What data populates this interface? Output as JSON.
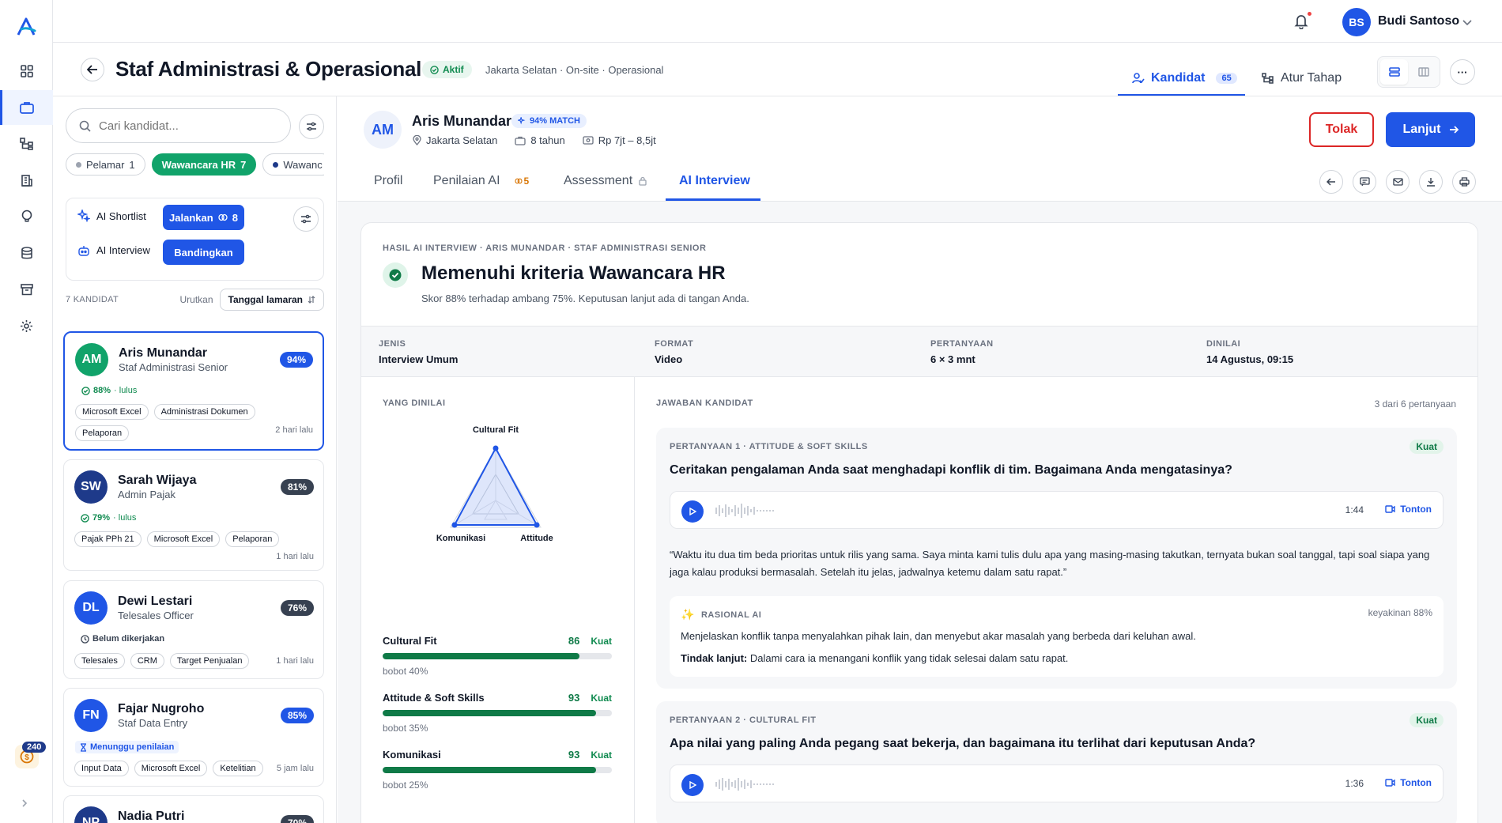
{
  "user": {
    "initials": "BS",
    "name": "Budi Santoso"
  },
  "credit_count": "240",
  "job": {
    "title": "Staf Administrasi & Operasional",
    "status": "Aktif",
    "meta": "Jakarta Selatan · On-site · Operasional"
  },
  "header_tabs": {
    "kandidat": "Kandidat",
    "kandidat_count": "65",
    "atur_tahap": "Atur Tahap"
  },
  "search": {
    "placeholder": "Cari kandidat..."
  },
  "stages": [
    {
      "label": "Pelamar",
      "count": "1"
    },
    {
      "label": "Wawancara HR",
      "count": "7"
    },
    {
      "label": "Wawanc"
    }
  ],
  "ai_tools": {
    "shortlist_label": "AI Shortlist",
    "shortlist_button": "Jalankan",
    "shortlist_credit": "8",
    "interview_label": "AI Interview",
    "interview_button": "Bandingkan"
  },
  "list_meta": {
    "count_label": "7 KANDIDAT",
    "sort_label": "Urutkan",
    "sort_value": "Tanggal lamaran"
  },
  "candidates": [
    {
      "initials": "AM",
      "name": "Aris Munandar",
      "role": "Staf Administrasi Senior",
      "match": "94%",
      "status_score": "88%",
      "status_suffix": "· lulus",
      "tags": [
        "Microsoft Excel",
        "Administrasi Dokumen",
        "Pelaporan"
      ],
      "ago": "2 hari lalu",
      "avatar_color": "#11a36a",
      "badge_color": "#2056e6"
    },
    {
      "initials": "SW",
      "name": "Sarah Wijaya",
      "role": "Admin Pajak",
      "match": "81%",
      "status_score": "79%",
      "status_suffix": "· lulus",
      "tags": [
        "Pajak PPh 21",
        "Microsoft Excel",
        "Pelaporan"
      ],
      "ago": "1 hari lalu",
      "avatar_color": "#1e3a8a",
      "badge_color": "#374151"
    },
    {
      "initials": "DL",
      "name": "Dewi Lestari",
      "role": "Telesales Officer",
      "match": "76%",
      "status_text": "Belum dikerjakan",
      "tags": [
        "Telesales",
        "CRM",
        "Target Penjualan"
      ],
      "ago": "1 hari lalu",
      "avatar_color": "#2056e6",
      "badge_color": "#374151"
    },
    {
      "initials": "FN",
      "name": "Fajar Nugroho",
      "role": "Staf Data Entry",
      "match": "85%",
      "status_text": "Menunggu penilaian",
      "tags": [
        "Input Data",
        "Microsoft Excel",
        "Ketelitian"
      ],
      "ago": "5 jam lalu",
      "avatar_color": "#2056e6",
      "badge_color": "#2056e6"
    },
    {
      "initials": "NP",
      "name": "Nadia Putri",
      "match": "70%",
      "avatar_color": "#1e3a8a",
      "badge_color": "#374151"
    }
  ],
  "selected": {
    "initials": "AM",
    "name": "Aris Munandar",
    "match": "94% MATCH",
    "location": "Jakarta Selatan",
    "experience": "8 tahun",
    "salary": "Rp 7jt – 8,5jt",
    "reject_label": "Tolak",
    "next_label": "Lanjut"
  },
  "detail_tabs": {
    "profil": "Profil",
    "penilaian": "Penilaian AI",
    "penilaian_count": "5",
    "assessment": "Assessment",
    "ai_interview": "AI Interview"
  },
  "result": {
    "eyebrow": "HASIL AI INTERVIEW · ARIS MUNANDAR · STAF ADMINISTRASI SENIOR",
    "title": "Memenuhi kriteria Wawancara HR",
    "subtitle": "Skor 88% terhadap ambang 75%. Keputusan lanjut ada di tangan Anda.",
    "meta": [
      {
        "k": "JENIS",
        "v": "Interview Umum"
      },
      {
        "k": "FORMAT",
        "v": "Video"
      },
      {
        "k": "PERTANYAAN",
        "v": "6 × 3 mnt"
      },
      {
        "k": "DINILAI",
        "v": "14 Agustus, 09:15"
      }
    ]
  },
  "assessed": {
    "title": "YANG DINILAI",
    "radar_labels": {
      "top": "Cultural Fit",
      "left": "Komunikasi",
      "right": "Attitude"
    },
    "scores": [
      {
        "name": "Cultural Fit",
        "value": 86,
        "level": "Kuat",
        "weight": "bobot 40%"
      },
      {
        "name": "Attitude & Soft Skills",
        "value": 93,
        "level": "Kuat",
        "weight": "bobot 35%"
      },
      {
        "name": "Komunikasi",
        "value": 93,
        "level": "Kuat",
        "weight": "bobot 25%"
      }
    ]
  },
  "answers": {
    "title": "JAWABAN KANDIDAT",
    "count": "3 dari 6 pertanyaan",
    "items": [
      {
        "eyebrow": "PERTANYAAN 1 · ATTITUDE & SOFT SKILLS",
        "level": "Kuat",
        "question": "Ceritakan pengalaman Anda saat menghadapi konflik di tim. Bagaimana Anda mengatasinya?",
        "duration": "1:44",
        "watch": "Tonton",
        "answer": "“Waktu itu dua tim beda prioritas untuk rilis yang sama. Saya minta kami tulis dulu apa yang masing-masing takutkan, ternyata bukan soal tanggal, tapi soal siapa yang jaga kalau produksi bermasalah. Setelah itu jelas, jadwalnya ketemu dalam satu rapat.”",
        "rationale_title": "RASIONAL AI",
        "confidence": "keyakinan 88%",
        "rationale": "Menjelaskan konflik tanpa menyalahkan pihak lain, dan menyebut akar masalah yang berbeda dari keluhan awal.",
        "followup_label": "Tindak lanjut:",
        "followup": "Dalami cara ia menangani konflik yang tidak selesai dalam satu rapat."
      },
      {
        "eyebrow": "PERTANYAAN 2 · CULTURAL FIT",
        "level": "Kuat",
        "question": "Apa nilai yang paling Anda pegang saat bekerja, dan bagaimana itu terlihat dari keputusan Anda?",
        "duration": "1:36",
        "watch": "Tonton"
      }
    ]
  }
}
